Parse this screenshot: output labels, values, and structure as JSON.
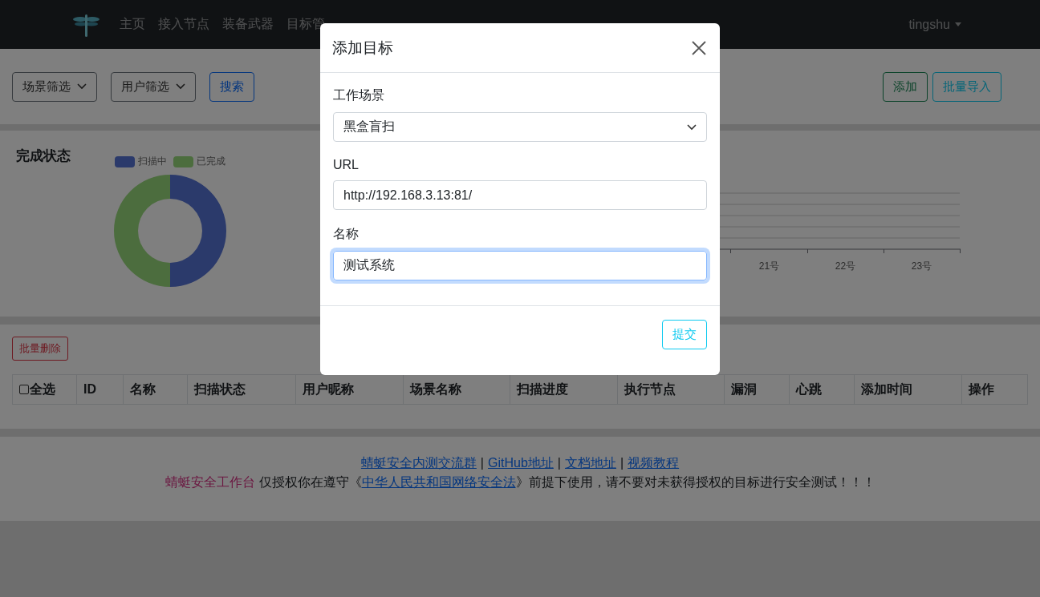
{
  "navbar": {
    "items": [
      {
        "label": "主页"
      },
      {
        "label": "接入节点"
      },
      {
        "label": "装备武器"
      },
      {
        "label": "目标管"
      }
    ],
    "user": "tingshu"
  },
  "toolbar": {
    "filters": [
      "场景筛选",
      "用户筛选"
    ],
    "search": "搜索",
    "actions": [
      {
        "label": "添加",
        "kind": "success"
      },
      {
        "label": "批量导入",
        "kind": "info"
      }
    ]
  },
  "status_panel": {
    "title": "完成状态",
    "legend": [
      {
        "label": "扫描中",
        "color": "#2b3a6b"
      },
      {
        "label": "已完成",
        "color": "#4c6d3e"
      }
    ]
  },
  "trend_panel": {
    "x_labels": [
      "21号",
      "22号",
      "23号"
    ]
  },
  "table": {
    "bulk_delete": "批量删除",
    "select_all": {
      "label": "全选",
      "checked": false
    },
    "columns": [
      "ID",
      "名称",
      "扫描状态",
      "用户昵称",
      "场景名称",
      "扫描进度",
      "执行节点",
      "漏洞",
      "心跳",
      "添加时间",
      "操作"
    ]
  },
  "footer": {
    "links": [
      "蜻蜓安全内测交流群",
      "GitHub地址",
      "文档地址",
      "视频教程"
    ],
    "separator": "|",
    "brand": "蜻蜓安全工作台",
    "notice_before": "仅授权你在遵守《",
    "law_link": "中华人民共和国网络安全法",
    "notice_after": "》前提下使用，请不要对未获得授权的目标进行安全测试！！！"
  },
  "modal": {
    "title": "添加目标",
    "fields": [
      {
        "label": "工作场景",
        "kind": "select",
        "value": "黑盒盲扫",
        "focused": false
      },
      {
        "label": "URL",
        "kind": "input",
        "value": "http://192.168.3.13:81/",
        "focused": false
      },
      {
        "label": "名称",
        "kind": "input",
        "value": "测试系统",
        "focused": true
      }
    ],
    "submit": "提交"
  }
}
